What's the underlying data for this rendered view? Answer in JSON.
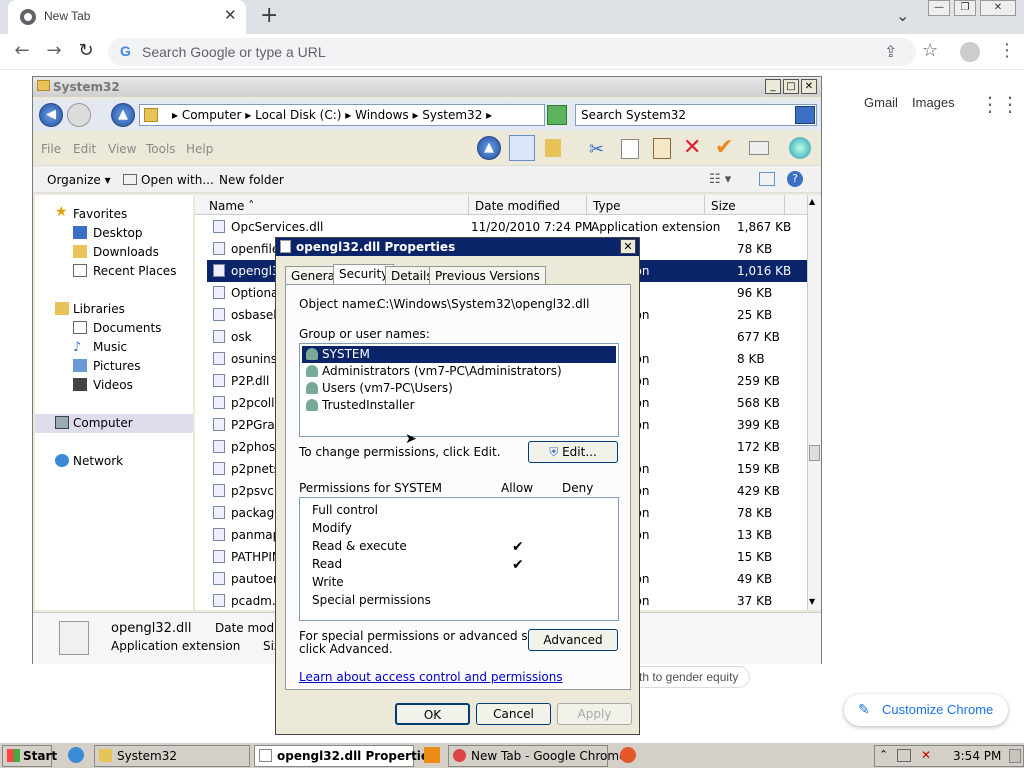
{
  "browser": {
    "tab_title": "New Tab",
    "tab_close": "✕",
    "new_tab": "+",
    "tab_search": "⌄",
    "omnibox_placeholder": "Search Google or type a URL",
    "back": "←",
    "forward": "→",
    "reload": "↻",
    "share": "⇪",
    "star": "☆",
    "menu": "⋮",
    "window_min": "—",
    "window_restore": "❐",
    "window_close": "✕",
    "ntp": {
      "gmail": "Gmail",
      "images": "Images",
      "apps": "⋮⋮⋮",
      "shortcut_text": "th to gender equity",
      "customize": "Customize Chrome"
    }
  },
  "explorer": {
    "title": "System32",
    "breadcrumb": "▸  Computer  ▸  Local Disk (C:)  ▸  Windows  ▸  System32  ▸",
    "search_placeholder": "Search System32",
    "menu": [
      "File",
      "Edit",
      "View",
      "Tools",
      "Help"
    ],
    "commands": {
      "organize": "Organize ▾",
      "open_with": "Open with...",
      "new_folder": "New folder"
    },
    "nav": {
      "favorites": "Favorites",
      "desktop": "Desktop",
      "downloads": "Downloads",
      "recent": "Recent Places",
      "libraries": "Libraries",
      "documents": "Documents",
      "music": "Music",
      "pictures": "Pictures",
      "videos": "Videos",
      "computer": "Computer",
      "network": "Network"
    },
    "columns": {
      "name": "Name",
      "date": "Date modified",
      "type": "Type",
      "size": "Size"
    },
    "files": [
      {
        "name": "OpcServices.dll",
        "date": "11/20/2010 7:24 PM",
        "type": "Application extension",
        "size": "1,867 KB"
      },
      {
        "name": "openfiles",
        "date": "",
        "type": "",
        "size": "78 KB"
      },
      {
        "name": "opengl32",
        "date": "",
        "type": "extension",
        "size": "1,016 KB"
      },
      {
        "name": "OptionalF",
        "date": "",
        "type": "",
        "size": "96 KB"
      },
      {
        "name": "osbaseln",
        "date": "",
        "type": "extension",
        "size": "25 KB"
      },
      {
        "name": "osk",
        "date": "",
        "type": "",
        "size": "677 KB"
      },
      {
        "name": "osuninst.",
        "date": "",
        "type": "extension",
        "size": "8 KB"
      },
      {
        "name": "P2P.dll",
        "date": "",
        "type": "extension",
        "size": "259 KB"
      },
      {
        "name": "p2pcollab",
        "date": "",
        "type": "extension",
        "size": "568 KB"
      },
      {
        "name": "P2PGraph",
        "date": "",
        "type": "extension",
        "size": "399 KB"
      },
      {
        "name": "p2phost",
        "date": "",
        "type": "",
        "size": "172 KB"
      },
      {
        "name": "p2pnetsh",
        "date": "",
        "type": "extension",
        "size": "159 KB"
      },
      {
        "name": "p2psvc.d",
        "date": "",
        "type": "extension",
        "size": "429 KB"
      },
      {
        "name": "packager",
        "date": "",
        "type": "extension",
        "size": "78 KB"
      },
      {
        "name": "panmap.",
        "date": "",
        "type": "extension",
        "size": "13 KB"
      },
      {
        "name": "PATHPIN",
        "date": "",
        "type": "",
        "size": "15 KB"
      },
      {
        "name": "pautoenr",
        "date": "",
        "type": "extension",
        "size": "49 KB"
      },
      {
        "name": "pcadm.dll",
        "date": "",
        "type": "extension",
        "size": "37 KB"
      }
    ],
    "details": {
      "name": "opengl32.dll",
      "type": "Application extension",
      "date_label": "Date modifie",
      "size_label": "Siz"
    }
  },
  "dialog": {
    "title": "opengl32.dll Properties",
    "close": "✕",
    "tabs": [
      "General",
      "Security",
      "Details",
      "Previous Versions"
    ],
    "object_label": "Object name:",
    "object_value": "C:\\Windows\\System32\\opengl32.dll",
    "group_label": "Group or user names:",
    "users": [
      "SYSTEM",
      "Administrators (vm7-PC\\Administrators)",
      "Users (vm7-PC\\Users)",
      "TrustedInstaller"
    ],
    "change_text": "To change permissions, click Edit.",
    "edit_button": "Edit...",
    "permissions_label": "Permissions for SYSTEM",
    "allow": "Allow",
    "deny": "Deny",
    "permissions": [
      {
        "name": "Full control",
        "allow": ""
      },
      {
        "name": "Modify",
        "allow": ""
      },
      {
        "name": "Read & execute",
        "allow": "✔"
      },
      {
        "name": "Read",
        "allow": "✔"
      },
      {
        "name": "Write",
        "allow": ""
      },
      {
        "name": "Special permissions",
        "allow": ""
      }
    ],
    "special_text_1": "For special permissions or advanced settings,",
    "special_text_2": "click Advanced.",
    "advanced_button": "Advanced",
    "learn_link": "Learn about access control and permissions",
    "ok": "OK",
    "cancel": "Cancel",
    "apply": "Apply"
  },
  "taskbar": {
    "start": "Start",
    "items": [
      "System32",
      "opengl32.dll Properties",
      "New Tab - Google Chrome"
    ],
    "clock": "3:54 PM"
  }
}
